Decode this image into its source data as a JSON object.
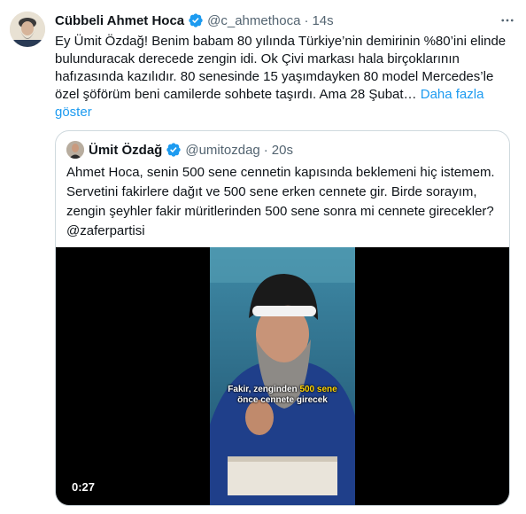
{
  "tweet": {
    "author_name": "Cübbeli Ahmet Hoca",
    "handle": "@c_ahmethoca",
    "separator": "·",
    "time": "14s",
    "text": "Ey Ümit Özdağ! Benim babam 80 yılında Türkiye’nin demirinin %80’ini elinde bulunduracak derecede zengin idi. Ok Çivi markası hala birçoklarının hafızasında kazılıdır. 80 senesinde 15 yaşımdayken 80 model Mercedes’le özel şöförüm beni camilerde sohbete taşırdı. Ama 28 Şubat…",
    "show_more": "Daha fazla göster",
    "more_icon": "more-horizontal-icon",
    "verified_icon": "verified-badge-icon"
  },
  "quote": {
    "author_name": "Ümit Özdağ",
    "handle": "@umitozdag",
    "separator": "·",
    "time": "20s",
    "text": "Ahmet Hoca, senin 500 sene cennetin kapısında beklemeni hiç istemem. Servetini fakirlere dağıt ve 500 sene erken cennete gir. Birde sorayım, zengin şeyhler fakir müritlerinden 500 sene sonra mi cennete girecekler? @zaferpartisi",
    "video": {
      "caption_part1": "Fakir, zenginden",
      "caption_highlight": "500 sene",
      "caption_line2": "önce cennete girecek",
      "duration": "0:27"
    }
  },
  "colors": {
    "link": "#1d9bf0",
    "secondary_text": "#536471",
    "border": "#cfd9de",
    "caption_highlight": "#ffd400"
  }
}
